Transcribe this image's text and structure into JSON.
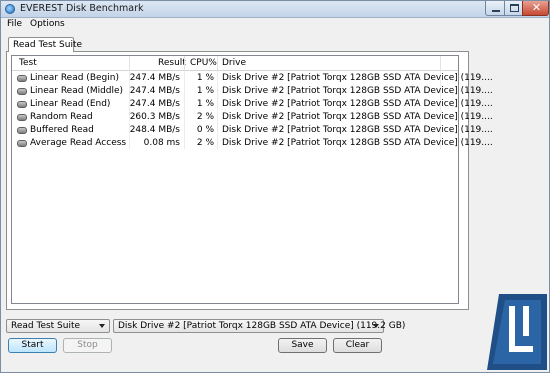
{
  "window": {
    "title": "EVEREST Disk Benchmark"
  },
  "menu": {
    "file": "File",
    "options": "Options"
  },
  "tab": {
    "label": "Read Test Suite"
  },
  "table": {
    "headers": {
      "test": "Test",
      "result": "Result",
      "cpu": "CPU%",
      "drive": "Drive"
    },
    "rows": [
      {
        "test": "Linear Read (Begin)",
        "result": "247.4 MB/s",
        "cpu": "1 %",
        "drive": "Disk Drive #2  [Patriot Torqx 128GB SSD ATA Device]  (119...."
      },
      {
        "test": "Linear Read (Middle)",
        "result": "247.4 MB/s",
        "cpu": "1 %",
        "drive": "Disk Drive #2  [Patriot Torqx 128GB SSD ATA Device]  (119...."
      },
      {
        "test": "Linear Read (End)",
        "result": "247.4 MB/s",
        "cpu": "1 %",
        "drive": "Disk Drive #2  [Patriot Torqx 128GB SSD ATA Device]  (119...."
      },
      {
        "test": "Random Read",
        "result": "260.3 MB/s",
        "cpu": "2 %",
        "drive": "Disk Drive #2  [Patriot Torqx 128GB SSD ATA Device]  (119...."
      },
      {
        "test": "Buffered Read",
        "result": "248.4 MB/s",
        "cpu": "0 %",
        "drive": "Disk Drive #2  [Patriot Torqx 128GB SSD ATA Device]  (119...."
      },
      {
        "test": "Average Read Access",
        "result": "0.08 ms",
        "cpu": "2 %",
        "drive": "Disk Drive #2  [Patriot Torqx 128GB SSD ATA Device]  (119...."
      }
    ]
  },
  "controls": {
    "suite_select": "Read Test Suite",
    "drive_select": "Disk Drive #2  [Patriot Torqx 128GB SSD ATA Device]  (119.2 GB)",
    "start": "Start",
    "stop": "Stop",
    "save": "Save",
    "clear": "Clear"
  },
  "colors": {
    "accent": "#3c7fb1",
    "close": "#c54a31",
    "logo_blue": "#1f4f86"
  }
}
